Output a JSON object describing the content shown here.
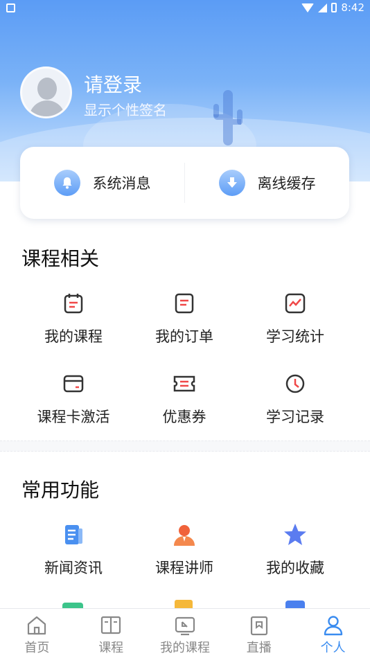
{
  "status_bar": {
    "time": "8:42"
  },
  "profile": {
    "title": "请登录",
    "subtitle": "显示个性签名"
  },
  "quick_actions": [
    {
      "label": "系统消息",
      "icon": "bell-icon"
    },
    {
      "label": "离线缓存",
      "icon": "download-icon"
    }
  ],
  "course_section": {
    "title": "课程相关",
    "items": [
      {
        "label": "我的课程",
        "icon": "calendar-icon"
      },
      {
        "label": "我的订单",
        "icon": "order-icon"
      },
      {
        "label": "学习统计",
        "icon": "chart-icon"
      },
      {
        "label": "课程卡激活",
        "icon": "card-icon"
      },
      {
        "label": "优惠券",
        "icon": "coupon-icon"
      },
      {
        "label": "学习记录",
        "icon": "clock-icon"
      }
    ]
  },
  "common_section": {
    "title": "常用功能",
    "items": [
      {
        "label": "新闻资讯",
        "icon": "news-icon"
      },
      {
        "label": "课程讲师",
        "icon": "teacher-icon"
      },
      {
        "label": "我的收藏",
        "icon": "star-icon"
      }
    ]
  },
  "bottom_nav": [
    {
      "label": "首页",
      "icon": "home-icon"
    },
    {
      "label": "课程",
      "icon": "book-icon"
    },
    {
      "label": "我的课程",
      "icon": "my-course-icon"
    },
    {
      "label": "直播",
      "icon": "live-icon"
    },
    {
      "label": "个人",
      "icon": "person-icon",
      "active": true
    }
  ],
  "colors": {
    "accent": "#3a8cf0",
    "header": "#5b9cf5",
    "icon_red": "#f04848",
    "icon_dark": "#333333"
  }
}
